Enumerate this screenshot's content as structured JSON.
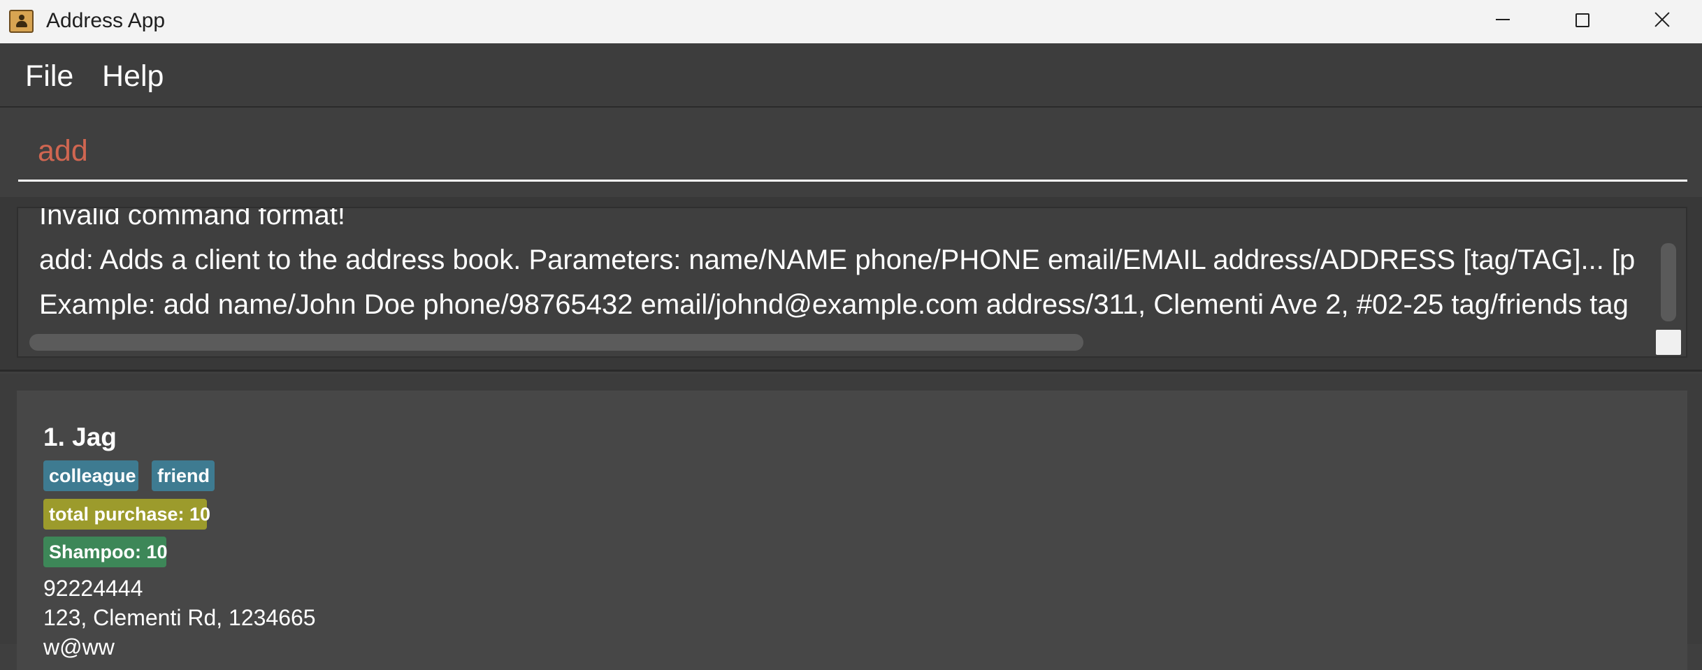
{
  "window": {
    "title": "Address App"
  },
  "menu": {
    "file": "File",
    "help": "Help"
  },
  "command": {
    "value": "add"
  },
  "result": {
    "text": "Invalid command format!\nadd: Adds a client to the address book. Parameters: name/NAME phone/PHONE email/EMAIL address/ADDRESS [tag/TAG]... [p\nExample: add name/John Doe phone/98765432 email/johnd@example.com address/311, Clementi Ave 2, #02-25 tag/friends tag"
  },
  "persons": [
    {
      "header": "1. Jag",
      "tags": [
        "colleague",
        "friend"
      ],
      "purchase": "total purchase: 10",
      "product": "Shampoo: 10",
      "phone": "92224444",
      "address": "123, Clementi Rd, 1234665",
      "email": "w@ww"
    }
  ],
  "colors": {
    "background": "#3f3f3f",
    "command_text": "#d06651",
    "tag_blue": "#3e7b91",
    "tag_yellow": "#9c9b2c",
    "tag_green": "#3d8758"
  }
}
